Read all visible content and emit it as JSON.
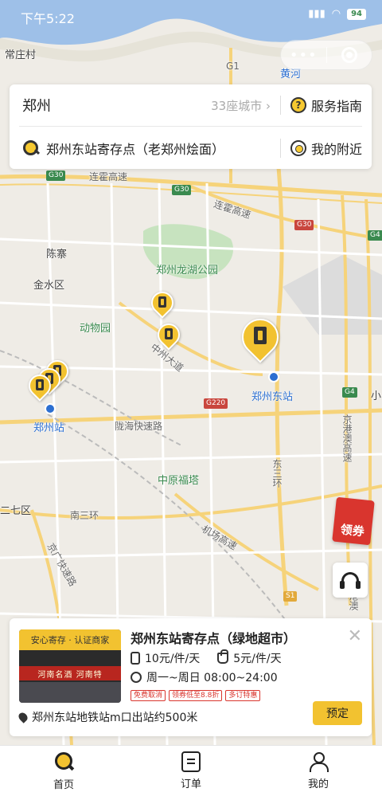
{
  "status_bar": {
    "time": "下午5:22",
    "battery": "94"
  },
  "search": {
    "city": "郑州",
    "city_count": "33座城市",
    "service_guide": "服务指南",
    "query": "郑州东站寄存点（老郑州烩面）",
    "nearby": "我的附近"
  },
  "map": {
    "labels": {
      "changzhuang": "常庄村",
      "huanghe": "黄河",
      "g1": "G1",
      "lianhuo": "连霍高速",
      "g30a": "G30",
      "g30b": "G30",
      "g30c": "G30",
      "lianhuo2": "连霍高速",
      "g4a": "G4",
      "g4b": "G4",
      "chenzhai": "陈寨",
      "longhu": "郑州龙湖公园",
      "jinshui": "金水区",
      "zoo": "动物园",
      "zhongzhou": "中州大道",
      "dongzhan": "郑州东站",
      "g220": "G220",
      "zhengzhou_station": "郑州站",
      "longhai": "陇海快速路",
      "jinggang": "京港澳高速",
      "dongsan": "东三环",
      "fuda": "中原福塔",
      "erqi": "二七区",
      "nansan": "南三环",
      "jichang": "机场高速",
      "jingguang": "京广快速路",
      "s1": "S1",
      "gangao": "港澳",
      "xiao": "小"
    }
  },
  "coupon": {
    "label": "领券"
  },
  "store": {
    "tag": "安心寄存 · 认证商家",
    "sign": "河南名酒 河南特",
    "name": "郑州东站寄存点（绿地超市）",
    "price_luggage": "10元/件/天",
    "price_bag": "5元/件/天",
    "hours": "周一~周日 08:00~24:00",
    "badges": [
      "免费取消",
      "领券低至8.8折",
      "多订特惠"
    ],
    "book": "预定",
    "address": "郑州东站地铁站m口出站约500米"
  },
  "tabs": [
    {
      "label": "首页",
      "icon": "search-icon"
    },
    {
      "label": "订单",
      "icon": "order-icon"
    },
    {
      "label": "我的",
      "icon": "user-icon"
    }
  ]
}
